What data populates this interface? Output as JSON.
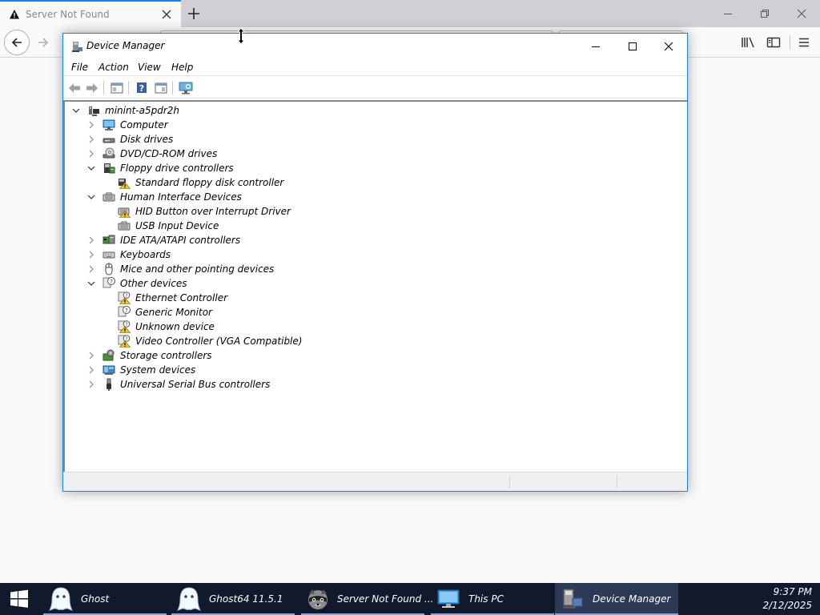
{
  "browser": {
    "tab_title": "Server Not Found",
    "new_tab_symbol": "+"
  },
  "device_manager": {
    "title": "Device Manager",
    "menu": [
      "File",
      "Action",
      "View",
      "Help"
    ],
    "tree": {
      "root": "minint-a5pdr2h",
      "items": [
        {
          "label": "Computer",
          "icon": "computer-icon",
          "expanded": false
        },
        {
          "label": "Disk drives",
          "icon": "disk-drive-icon",
          "expanded": false
        },
        {
          "label": "DVD/CD-ROM drives",
          "icon": "dvd-drive-icon",
          "expanded": false
        },
        {
          "label": "Floppy drive controllers",
          "icon": "floppy-controller-icon",
          "expanded": true
        },
        {
          "label": "Standard floppy disk controller",
          "icon": "warning-device-icon",
          "child": true
        },
        {
          "label": "Human Interface Devices",
          "icon": "hid-icon",
          "expanded": true
        },
        {
          "label": "HID Button over Interrupt Driver",
          "icon": "hid-warning-icon",
          "child": true
        },
        {
          "label": "USB Input Device",
          "icon": "hid-icon",
          "child": true
        },
        {
          "label": "IDE ATA/ATAPI controllers",
          "icon": "ide-controller-icon",
          "expanded": false
        },
        {
          "label": "Keyboards",
          "icon": "keyboard-icon",
          "expanded": false
        },
        {
          "label": "Mice and other pointing devices",
          "icon": "mouse-icon",
          "expanded": false
        },
        {
          "label": "Other devices",
          "icon": "other-devices-icon",
          "expanded": true
        },
        {
          "label": "Ethernet Controller",
          "icon": "unknown-warning-icon",
          "child": true
        },
        {
          "label": "Generic Monitor",
          "icon": "unknown-device-icon",
          "child": true
        },
        {
          "label": "Unknown device",
          "icon": "unknown-warning-icon",
          "child": true
        },
        {
          "label": "Video Controller (VGA Compatible)",
          "icon": "unknown-warning-icon",
          "child": true
        },
        {
          "label": "Storage controllers",
          "icon": "storage-controller-icon",
          "expanded": false
        },
        {
          "label": "System devices",
          "icon": "system-devices-icon",
          "expanded": false
        },
        {
          "label": "Universal Serial Bus controllers",
          "icon": "usb-icon",
          "expanded": false
        }
      ]
    }
  },
  "taskbar": {
    "items": [
      {
        "label": "Ghost",
        "icon": "ghost-icon"
      },
      {
        "label": "Ghost64 11.5.1",
        "icon": "ghost-icon"
      },
      {
        "label": "Server Not Found ...",
        "icon": "raccoon-icon"
      },
      {
        "label": "This PC",
        "icon": "this-pc-icon"
      },
      {
        "label": "Device Manager",
        "icon": "device-manager-icon",
        "active": true
      }
    ],
    "time": "9:37 PM",
    "date": "2/12/2025"
  },
  "colors": {
    "accent": "#1883d7",
    "taskbar": "#101a2c",
    "taskbar_active": "#2c3a56",
    "warning": "#f5c518"
  }
}
